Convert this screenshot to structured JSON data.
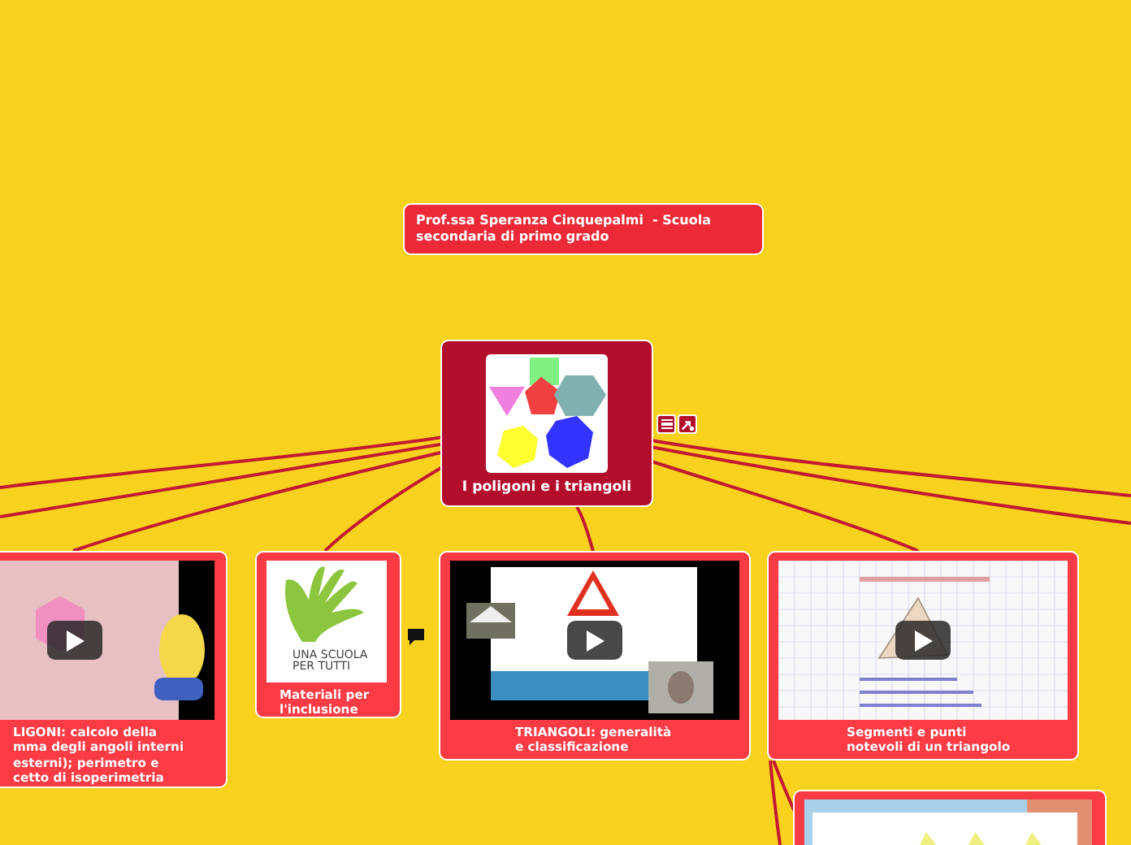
{
  "note": {
    "text": "Prof.ssa Speranza Cinquepalmi  - Scuola secondaria di primo grado"
  },
  "central": {
    "title": "I poligoni e i triangoli"
  },
  "topics": [
    {
      "kind": "video",
      "label": "LIGONI: calcolo della\nmma degli angoli interni\nesterni); perimetro e\ncetto di isoperimetria"
    },
    {
      "kind": "logo",
      "logo_text": "UNA SCUOLA\nPER TUTTI",
      "label": "Materiali per\nl'inclusione"
    },
    {
      "kind": "video",
      "label": "TRIANGOLI: generalità\ne classificazione"
    },
    {
      "kind": "video",
      "label": "Segmenti e punti\nnotevoli di un triangolo"
    },
    {
      "kind": "picture"
    }
  ]
}
